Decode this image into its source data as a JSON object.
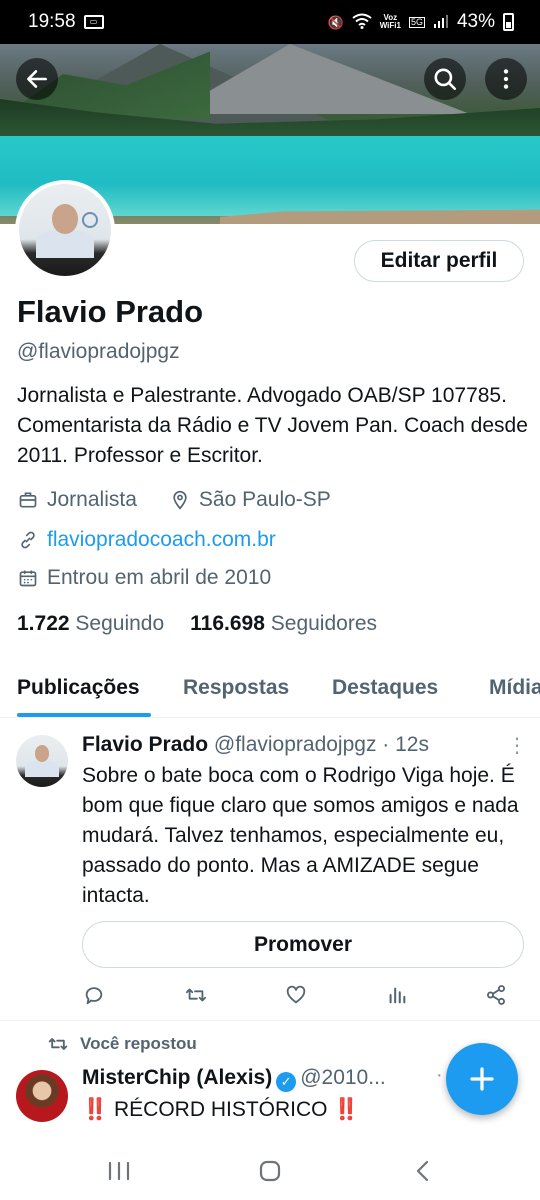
{
  "status_bar": {
    "time": "19:58",
    "voz_wifi": "Voz\nWiFi1",
    "network": "5G",
    "battery": "43%"
  },
  "header": {
    "back_icon": "arrow-left-icon",
    "search_icon": "search-icon",
    "more_icon": "more-vertical-icon"
  },
  "profile": {
    "edit_button": "Editar perfil",
    "name": "Flavio Prado",
    "handle": "@flaviopradojpgz",
    "bio": "Jornalista e Palestrante. Advogado OAB/SP 107785. Comentarista da Rádio e TV Jovem Pan. Coach desde 2011. Professor e Escritor.",
    "occupation": "Jornalista",
    "location": "São Paulo-SP",
    "website": "flaviopradocoach.com.br",
    "joined": "Entrou em abril de 2010",
    "following_count": "1.722",
    "following_label": "Seguindo",
    "followers_count": "116.698",
    "followers_label": "Seguidores"
  },
  "tabs": [
    {
      "label": "Publicações",
      "active": true
    },
    {
      "label": "Respostas",
      "active": false
    },
    {
      "label": "Destaques",
      "active": false
    },
    {
      "label": "Mídia",
      "active": false
    }
  ],
  "tweets": [
    {
      "name": "Flavio Prado",
      "handle_time": "@flaviopradojpgz · 12s",
      "text": "Sobre o bate boca com o Rodrigo Viga hoje. É bom que fique claro que somos amigos e nada mudará. Talvez tenhamos, especialmente eu, passado do ponto. Mas a AMIZADE segue intacta.",
      "promote_label": "Promover"
    }
  ],
  "repost": {
    "label": "Você repostou",
    "name": "MisterChip (Alexis)",
    "handle": "@2010...",
    "bang": "‼️",
    "text": "RÉCORD HISTÓRICO"
  },
  "colors": {
    "accent": "#1d9bf0",
    "text": "#0f1419",
    "secondary": "#536471"
  }
}
